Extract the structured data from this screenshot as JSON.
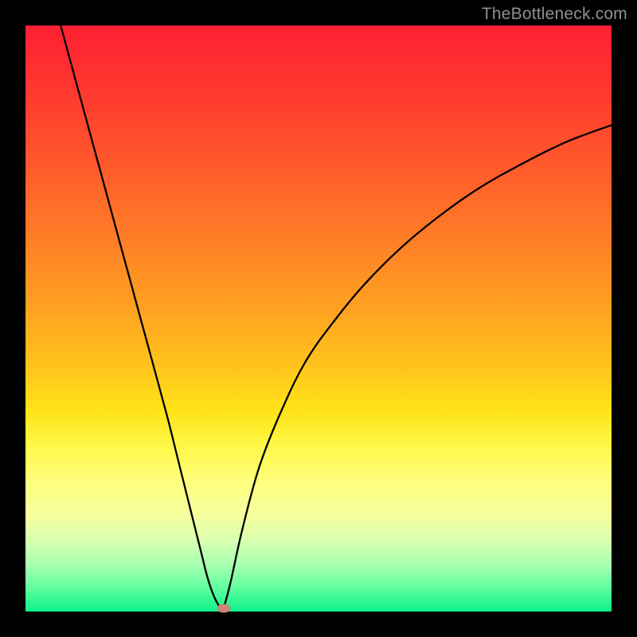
{
  "watermark": "TheBottleneck.com",
  "colors": {
    "top": "#ff1f33",
    "mid_upper": "#ff9c22",
    "mid": "#ffe418",
    "lower": "#5fff9e",
    "bottom": "#0df08a",
    "curve": "#000000",
    "marker": "#cf8276",
    "frame": "#000000"
  },
  "chart_data": {
    "type": "line",
    "title": "",
    "xlabel": "",
    "ylabel": "",
    "xlim": [
      0,
      100
    ],
    "ylim": [
      0,
      100
    ],
    "grid": false,
    "series": [
      {
        "name": "left-branch",
        "x": [
          6,
          9,
          12,
          15,
          18,
          21,
          24,
          26,
          28,
          30,
          31,
          32,
          33,
          33.8
        ],
        "values": [
          100,
          89,
          78,
          67,
          56,
          45,
          34,
          26,
          18,
          10,
          6,
          3,
          1,
          0.5
        ]
      },
      {
        "name": "right-branch",
        "x": [
          33.8,
          35,
          37,
          40,
          44,
          48,
          53,
          58,
          64,
          70,
          77,
          84,
          92,
          100
        ],
        "values": [
          0.5,
          5,
          14,
          25,
          35,
          43,
          50,
          56,
          62,
          67,
          72,
          76,
          80,
          83
        ]
      }
    ],
    "marker": {
      "x": 33.8,
      "y": 0.5,
      "color": "#cf8276"
    },
    "background_gradient": {
      "direction": "vertical",
      "stops": [
        {
          "pos": 0,
          "color": "#ff1f33"
        },
        {
          "pos": 50,
          "color": "#ffa021"
        },
        {
          "pos": 72,
          "color": "#fff84a"
        },
        {
          "pos": 100,
          "color": "#0df08a"
        }
      ]
    }
  }
}
